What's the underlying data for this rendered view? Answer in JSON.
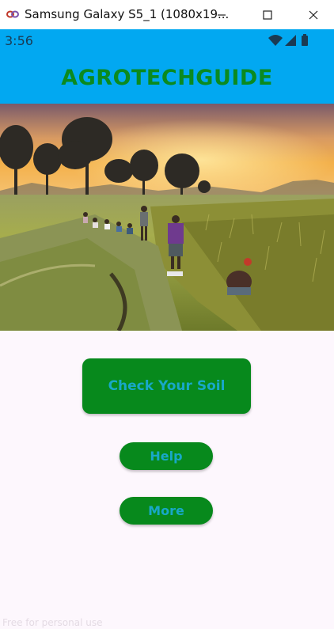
{
  "window": {
    "title": "Samsung Galaxy S5_1 (1080x19...",
    "icon": "link-icon"
  },
  "status_bar": {
    "time": "3:56",
    "icons": [
      "wifi-icon",
      "cell-signal-icon",
      "battery-icon"
    ]
  },
  "header": {
    "title": "AGROTECHGUIDE"
  },
  "hero": {
    "description_icon": "rice-field-sunset-image"
  },
  "buttons": {
    "check_soil": "Check Your Soil",
    "help": "Help",
    "more": "More"
  },
  "watermark": "Free for personal use",
  "colors": {
    "header_bg": "#02a8f1",
    "title_green": "#0b8a1f",
    "button_green": "#07891c",
    "button_text": "#18a8c8",
    "page_bg": "#fdf7fd"
  }
}
